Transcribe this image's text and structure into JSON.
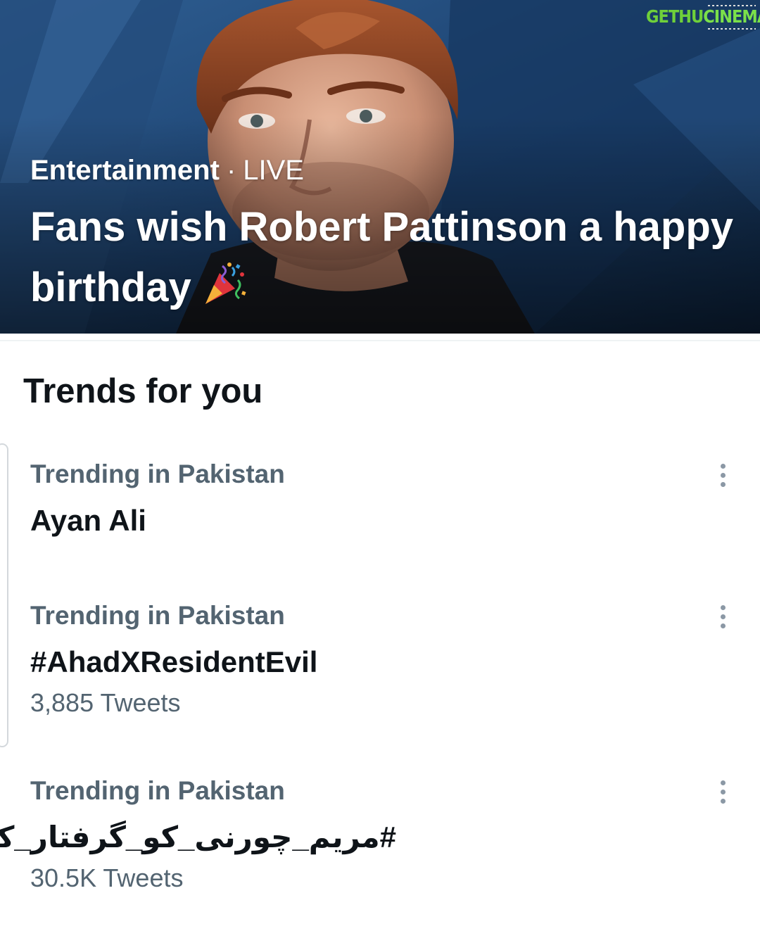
{
  "hero": {
    "category": "Entertainment",
    "separator": "·",
    "live_label": "LIVE",
    "title": "Fans wish Robert Pattinson a happy birthday",
    "title_emoji_icon": "party-popper-icon",
    "image_icon": "celebrity-photo"
  },
  "watermark": {
    "part_a": "GETHU",
    "part_b": "CINEMA"
  },
  "trends": {
    "heading": "Trends for you",
    "items": [
      {
        "context": "Trending in Pakistan",
        "name": "Ayan Ali",
        "count": ""
      },
      {
        "context": "Trending in Pakistan",
        "name": "#AhadXResidentEvil",
        "count": "3,885 Tweets"
      },
      {
        "context": "Trending in Pakistan",
        "name": "#مریم_چورنی_کو_گرفتار_کرو",
        "count": "30.5K Tweets"
      }
    ]
  },
  "colors": {
    "hero_bg": "#1b3d67",
    "primary_text": "#0f1419",
    "secondary_text": "#536471",
    "watermark_green": "#6fd03a"
  }
}
